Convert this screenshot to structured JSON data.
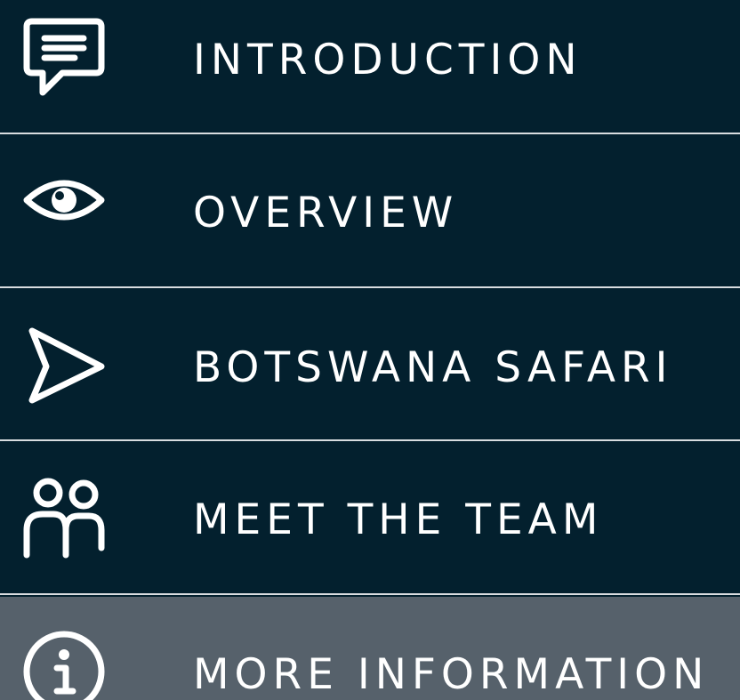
{
  "menu": {
    "items": [
      {
        "label": "INTRODUCTION",
        "icon": "speech-bubble-icon"
      },
      {
        "label": "OVERVIEW",
        "icon": "eye-icon"
      },
      {
        "label": "BOTSWANA SAFARI",
        "icon": "send-arrow-icon"
      },
      {
        "label": "MEET THE TEAM",
        "icon": "people-icon"
      },
      {
        "label": "MORE INFORMATION",
        "icon": "info-icon",
        "active": true
      }
    ]
  },
  "colors": {
    "background": "#03202e",
    "active_background": "#56616b",
    "divider": "#d9dde0",
    "text": "#ffffff"
  }
}
